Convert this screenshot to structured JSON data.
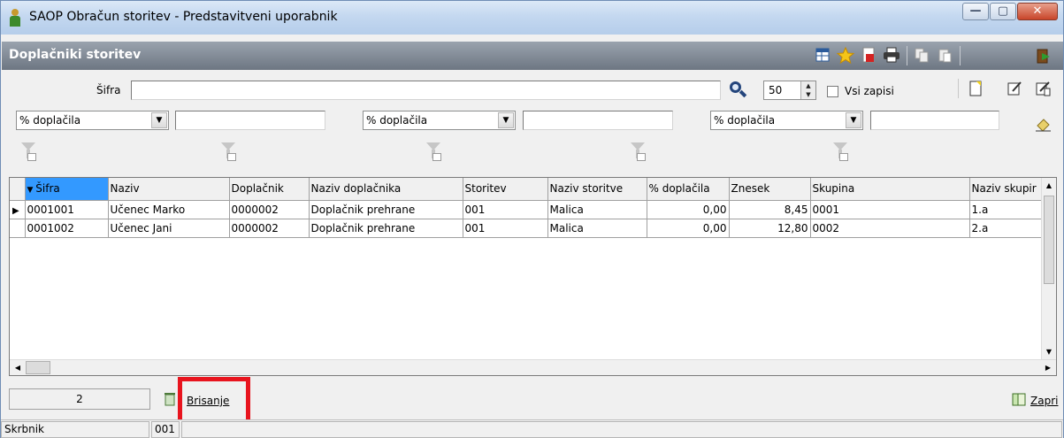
{
  "window": {
    "title": "SAOP Obračun storitev - Predstavitveni uporabnik",
    "minimize": "—",
    "maximize": "▢",
    "close": "✕"
  },
  "header": {
    "title": "Doplačniki storitev",
    "icons": [
      "table-view-icon",
      "favorite-star-icon",
      "export-pdf-icon",
      "print-icon",
      "copy-icon",
      "paste-icon",
      "exit-door-icon"
    ]
  },
  "search": {
    "label": "Šifra",
    "value": "",
    "limit": "50",
    "all_records_label": "Vsi zapisi"
  },
  "filters": [
    {
      "field": "% doplačila",
      "value": ""
    },
    {
      "field": "% doplačila",
      "value": ""
    },
    {
      "field": "% doplačila",
      "value": ""
    }
  ],
  "table": {
    "columns": [
      "Šifra",
      "Naziv",
      "Doplačnik",
      "Naziv doplačnika",
      "Storitev",
      "Naziv storitve",
      "% doplačila",
      "Znesek",
      "Skupina",
      "Naziv skupir"
    ],
    "rows": [
      [
        "0001001",
        "Učenec Marko",
        "0000002",
        "Doplačnik prehrane",
        "001",
        "Malica",
        "0,00",
        "8,45",
        "0001",
        "1.a"
      ],
      [
        "0001002",
        "Učenec Jani",
        "0000002",
        "Doplačnik prehrane",
        "001",
        "Malica",
        "0,00",
        "12,80",
        "0002",
        "2.a"
      ]
    ]
  },
  "footer": {
    "count": "2",
    "delete_label": "Brisanje",
    "close_label": "Zapri"
  },
  "status": {
    "user": "Skrbnik",
    "code": "001"
  },
  "colors": {
    "sorted_header": "#3399ff",
    "highlight": "#e8141e",
    "header_strip": "#7d8591"
  }
}
